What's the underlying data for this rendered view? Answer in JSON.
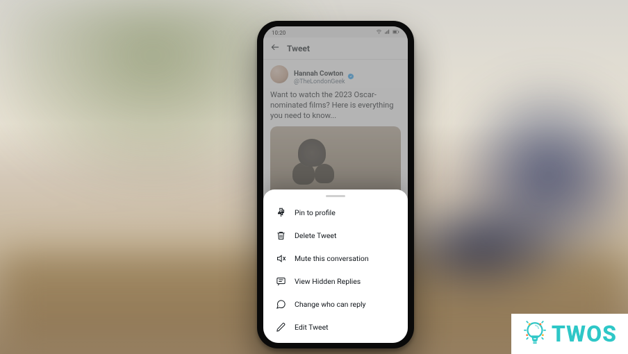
{
  "statusbar": {
    "time": "10:20",
    "signal_icons": "▿ ⫽ ▯"
  },
  "topbar": {
    "title": "Tweet"
  },
  "tweet": {
    "author_name": "Hannah Cowton",
    "author_handle": "@TheLondonGeek",
    "text": "Want to watch the 2023 Oscar-nominated films? Here is everything you need to know..."
  },
  "menu": {
    "items": [
      {
        "label": "Pin to profile",
        "icon": "pin-icon"
      },
      {
        "label": "Delete Tweet",
        "icon": "trash-icon"
      },
      {
        "label": "Mute this conversation",
        "icon": "mute-icon"
      },
      {
        "label": "View Hidden Replies",
        "icon": "replies-icon"
      },
      {
        "label": "Change who can reply",
        "icon": "reply-bubble-icon"
      },
      {
        "label": "Edit Tweet",
        "icon": "edit-icon"
      }
    ]
  },
  "watermark": {
    "text": "TWOS"
  }
}
